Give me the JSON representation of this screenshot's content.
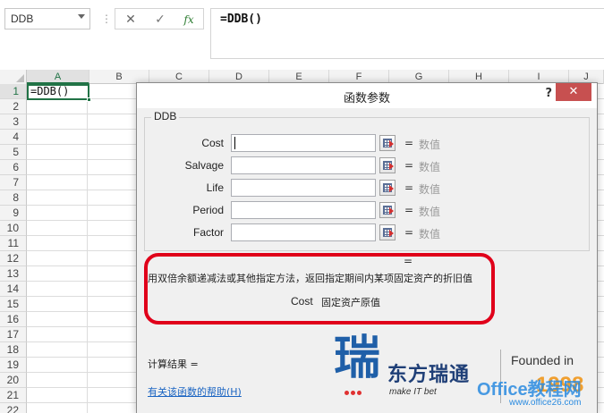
{
  "formula_bar": {
    "name_box": "DDB",
    "fx_label": "fx",
    "cancel_symbol": "✕",
    "enter_symbol": "✓",
    "formula": "=DDB()"
  },
  "sheet": {
    "columns": [
      "A",
      "B",
      "C",
      "D",
      "E",
      "F",
      "G",
      "H",
      "I",
      "J"
    ],
    "rows": [
      "1",
      "2",
      "3",
      "4",
      "5",
      "6",
      "7",
      "8",
      "9",
      "10",
      "11",
      "12",
      "13",
      "14",
      "15",
      "16",
      "17",
      "18",
      "19",
      "20",
      "21",
      "22"
    ],
    "active_cell_value": "=DDB()"
  },
  "dialog": {
    "title": "函数参数",
    "help_button": "?",
    "close_button": "✕",
    "function_name": "DDB",
    "arguments": [
      {
        "label": "Cost",
        "value": "",
        "eq": "=",
        "hint": "数值"
      },
      {
        "label": "Salvage",
        "value": "",
        "eq": "=",
        "hint": "数值"
      },
      {
        "label": "Life",
        "value": "",
        "eq": "=",
        "hint": "数值"
      },
      {
        "label": "Period",
        "value": "",
        "eq": "=",
        "hint": "数值"
      },
      {
        "label": "Factor",
        "value": "",
        "eq": "=",
        "hint": "数值"
      }
    ],
    "result_eq": "=",
    "description": "用双倍余额递减法或其他指定方法，返回指定期间内某项固定资产的折旧值",
    "arg_desc_name": "Cost",
    "arg_desc_text": "固定资产原值",
    "calc_result_label": "计算结果 =",
    "help_link": "有关该函数的帮助(H)",
    "highlight_color": "#e0001a"
  },
  "watermark": {
    "char": "瑞",
    "company": "东方瑞通",
    "slogan": "make IT bet",
    "founded": "Founded in",
    "site": "Office教程网",
    "url": "www.office26.com",
    "num": "1998"
  }
}
